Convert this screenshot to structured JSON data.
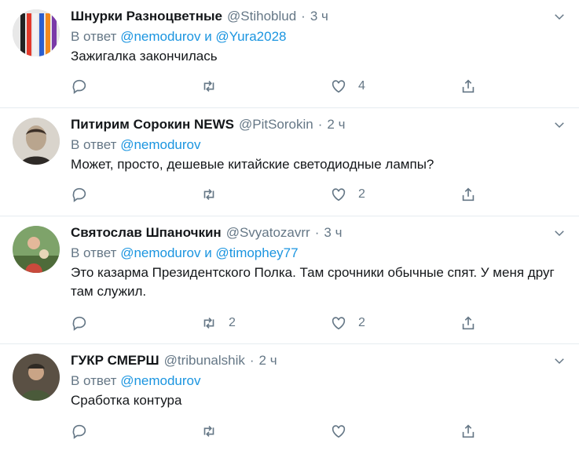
{
  "colors": {
    "link": "#1b95e0",
    "secondary": "#657786",
    "border": "#e6ecf0"
  },
  "tweets": [
    {
      "name": "Шнурки Разноцветные",
      "handle": "@Stihoblud",
      "time": "3 ч",
      "reply_prefix": "В ответ",
      "reply_users": "@nemodurov и @Yura2028",
      "text": "Зажигалка закончилась",
      "reply_count": "",
      "retweet_count": "",
      "like_count": "4",
      "avatar_icon": "shoelaces-avatar"
    },
    {
      "name": "Питирим Сорокин NEWS",
      "handle": "@PitSorokin",
      "time": "2 ч",
      "reply_prefix": "В ответ",
      "reply_users": "@nemodurov",
      "text": "Может, просто, дешевые китайские светодиодные лампы?",
      "reply_count": "",
      "retweet_count": "",
      "like_count": "2",
      "avatar_icon": "portrait-avatar"
    },
    {
      "name": "Святослав Шпаночкин",
      "handle": "@Svyatozavrr",
      "time": "3 ч",
      "reply_prefix": "В ответ",
      "reply_users": "@nemodurov и @timophey77",
      "text": "Это казарма Президентского Полка. Там срочники обычные спят. У меня друг там служил.",
      "reply_count": "",
      "retweet_count": "2",
      "like_count": "2",
      "avatar_icon": "outdoor-avatar"
    },
    {
      "name": "ГУКР СМЕРШ",
      "handle": "@tribunalshik",
      "time": "2 ч",
      "reply_prefix": "В ответ",
      "reply_users": "@nemodurov",
      "text": "Сработка контура",
      "reply_count": "",
      "retweet_count": "",
      "like_count": "",
      "avatar_icon": "soldier-avatar"
    }
  ]
}
